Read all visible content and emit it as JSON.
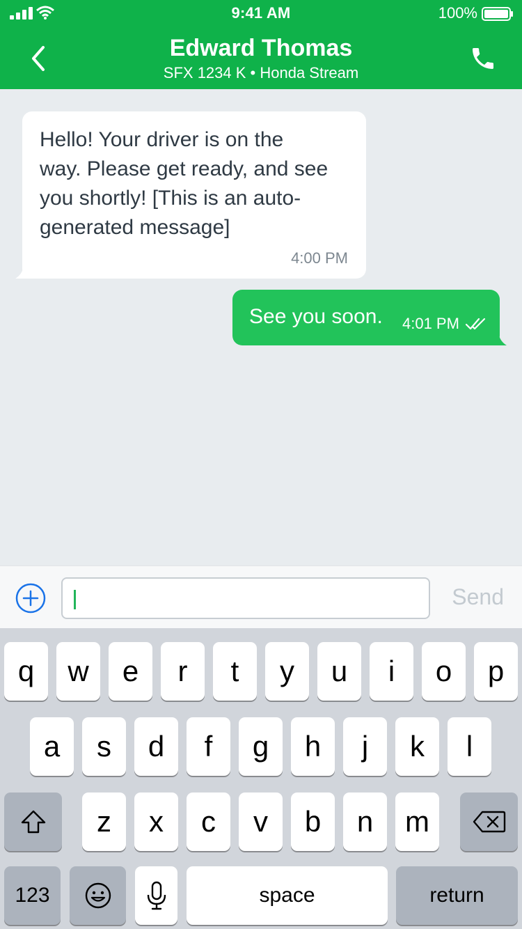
{
  "status_bar": {
    "time": "9:41 AM",
    "battery": "100%"
  },
  "header": {
    "title": "Edward Thomas",
    "subtitle": "SFX 1234 K • Honda Stream",
    "back_icon": "chevron-left-icon",
    "call_icon": "phone-icon"
  },
  "messages": [
    {
      "direction": "incoming",
      "lines": [
        "Hello! Your driver is on the",
        "way. Please get ready, and see",
        "you shortly! [This is an auto-",
        "generated message]"
      ],
      "time": "4:00 PM"
    },
    {
      "direction": "outgoing",
      "text": "See you soon.",
      "time": "4:01 PM",
      "status_icon": "double-check-icon"
    }
  ],
  "composer": {
    "value": "",
    "send_label": "Send",
    "add_icon": "plus-circle-icon"
  },
  "keyboard": {
    "row1": [
      "q",
      "w",
      "e",
      "r",
      "t",
      "y",
      "u",
      "i",
      "o",
      "p"
    ],
    "row2": [
      "a",
      "s",
      "d",
      "f",
      "g",
      "h",
      "j",
      "k",
      "l"
    ],
    "row3": [
      "z",
      "x",
      "c",
      "v",
      "b",
      "n",
      "m"
    ],
    "numbers_label": "123",
    "space_label": "space",
    "return_label": "return"
  },
  "colors": {
    "brand_green": "#0fb24a",
    "outgoing_bubble": "#22c35a",
    "chat_background": "#e8ecef",
    "link_blue": "#1a73e8"
  }
}
